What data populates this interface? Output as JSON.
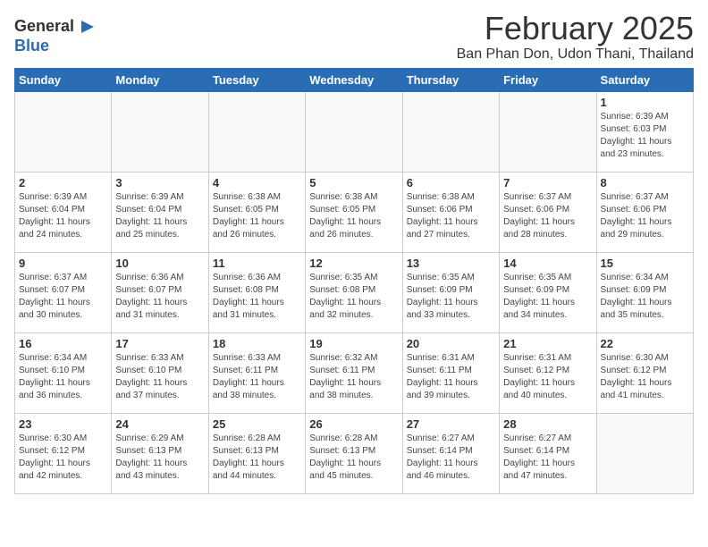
{
  "logo": {
    "general": "General",
    "blue": "Blue",
    "icon": "▶"
  },
  "title": "February 2025",
  "subtitle": "Ban Phan Don, Udon Thani, Thailand",
  "days_of_week": [
    "Sunday",
    "Monday",
    "Tuesday",
    "Wednesday",
    "Thursday",
    "Friday",
    "Saturday"
  ],
  "weeks": [
    [
      {
        "day": "",
        "info": ""
      },
      {
        "day": "",
        "info": ""
      },
      {
        "day": "",
        "info": ""
      },
      {
        "day": "",
        "info": ""
      },
      {
        "day": "",
        "info": ""
      },
      {
        "day": "",
        "info": ""
      },
      {
        "day": "1",
        "info": "Sunrise: 6:39 AM\nSunset: 6:03 PM\nDaylight: 11 hours\nand 23 minutes."
      }
    ],
    [
      {
        "day": "2",
        "info": "Sunrise: 6:39 AM\nSunset: 6:04 PM\nDaylight: 11 hours\nand 24 minutes."
      },
      {
        "day": "3",
        "info": "Sunrise: 6:39 AM\nSunset: 6:04 PM\nDaylight: 11 hours\nand 25 minutes."
      },
      {
        "day": "4",
        "info": "Sunrise: 6:38 AM\nSunset: 6:05 PM\nDaylight: 11 hours\nand 26 minutes."
      },
      {
        "day": "5",
        "info": "Sunrise: 6:38 AM\nSunset: 6:05 PM\nDaylight: 11 hours\nand 26 minutes."
      },
      {
        "day": "6",
        "info": "Sunrise: 6:38 AM\nSunset: 6:06 PM\nDaylight: 11 hours\nand 27 minutes."
      },
      {
        "day": "7",
        "info": "Sunrise: 6:37 AM\nSunset: 6:06 PM\nDaylight: 11 hours\nand 28 minutes."
      },
      {
        "day": "8",
        "info": "Sunrise: 6:37 AM\nSunset: 6:06 PM\nDaylight: 11 hours\nand 29 minutes."
      }
    ],
    [
      {
        "day": "9",
        "info": "Sunrise: 6:37 AM\nSunset: 6:07 PM\nDaylight: 11 hours\nand 30 minutes."
      },
      {
        "day": "10",
        "info": "Sunrise: 6:36 AM\nSunset: 6:07 PM\nDaylight: 11 hours\nand 31 minutes."
      },
      {
        "day": "11",
        "info": "Sunrise: 6:36 AM\nSunset: 6:08 PM\nDaylight: 11 hours\nand 31 minutes."
      },
      {
        "day": "12",
        "info": "Sunrise: 6:35 AM\nSunset: 6:08 PM\nDaylight: 11 hours\nand 32 minutes."
      },
      {
        "day": "13",
        "info": "Sunrise: 6:35 AM\nSunset: 6:09 PM\nDaylight: 11 hours\nand 33 minutes."
      },
      {
        "day": "14",
        "info": "Sunrise: 6:35 AM\nSunset: 6:09 PM\nDaylight: 11 hours\nand 34 minutes."
      },
      {
        "day": "15",
        "info": "Sunrise: 6:34 AM\nSunset: 6:09 PM\nDaylight: 11 hours\nand 35 minutes."
      }
    ],
    [
      {
        "day": "16",
        "info": "Sunrise: 6:34 AM\nSunset: 6:10 PM\nDaylight: 11 hours\nand 36 minutes."
      },
      {
        "day": "17",
        "info": "Sunrise: 6:33 AM\nSunset: 6:10 PM\nDaylight: 11 hours\nand 37 minutes."
      },
      {
        "day": "18",
        "info": "Sunrise: 6:33 AM\nSunset: 6:11 PM\nDaylight: 11 hours\nand 38 minutes."
      },
      {
        "day": "19",
        "info": "Sunrise: 6:32 AM\nSunset: 6:11 PM\nDaylight: 11 hours\nand 38 minutes."
      },
      {
        "day": "20",
        "info": "Sunrise: 6:31 AM\nSunset: 6:11 PM\nDaylight: 11 hours\nand 39 minutes."
      },
      {
        "day": "21",
        "info": "Sunrise: 6:31 AM\nSunset: 6:12 PM\nDaylight: 11 hours\nand 40 minutes."
      },
      {
        "day": "22",
        "info": "Sunrise: 6:30 AM\nSunset: 6:12 PM\nDaylight: 11 hours\nand 41 minutes."
      }
    ],
    [
      {
        "day": "23",
        "info": "Sunrise: 6:30 AM\nSunset: 6:12 PM\nDaylight: 11 hours\nand 42 minutes."
      },
      {
        "day": "24",
        "info": "Sunrise: 6:29 AM\nSunset: 6:13 PM\nDaylight: 11 hours\nand 43 minutes."
      },
      {
        "day": "25",
        "info": "Sunrise: 6:28 AM\nSunset: 6:13 PM\nDaylight: 11 hours\nand 44 minutes."
      },
      {
        "day": "26",
        "info": "Sunrise: 6:28 AM\nSunset: 6:13 PM\nDaylight: 11 hours\nand 45 minutes."
      },
      {
        "day": "27",
        "info": "Sunrise: 6:27 AM\nSunset: 6:14 PM\nDaylight: 11 hours\nand 46 minutes."
      },
      {
        "day": "28",
        "info": "Sunrise: 6:27 AM\nSunset: 6:14 PM\nDaylight: 11 hours\nand 47 minutes."
      },
      {
        "day": "",
        "info": ""
      }
    ]
  ]
}
